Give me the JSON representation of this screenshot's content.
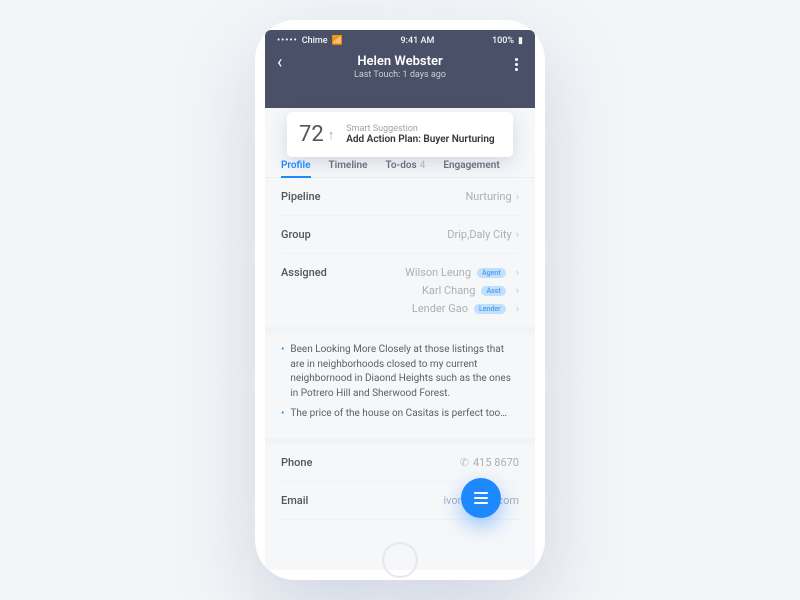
{
  "status": {
    "carrier": "Chime",
    "time": "9:41 AM",
    "battery": "100%"
  },
  "header": {
    "name": "Helen Webster",
    "subtitle": "Last Touch: 1 days ago"
  },
  "suggestion": {
    "score": "72",
    "label": "Smart Suggestion",
    "action": "Add Action Plan: Buyer Nurturing"
  },
  "tabs": {
    "profile": "Profile",
    "timeline": "Timeline",
    "todos": "To-dos",
    "todos_count": "4",
    "engagement": "Engagement"
  },
  "profile": {
    "pipeline_k": "Pipeline",
    "pipeline_v": "Nurturing",
    "group_k": "Group",
    "group_v": "Drip,Daly City",
    "assigned_k": "Assigned",
    "assigned": [
      {
        "name": "Wilson Leung",
        "role": "Agent"
      },
      {
        "name": "Karl Chang",
        "role": "Asst"
      },
      {
        "name": "Lender Gao",
        "role": "Lender"
      }
    ]
  },
  "notes": {
    "n1": "Been Looking More Closely at those listings that are in neighborhoods closed to my current neighbornood in Diaond Heights such as the ones in Potrero Hill and Sherwood Forest.",
    "n2": "The price of the house on Casitas is perfect too…"
  },
  "contact": {
    "phone_k": "Phone",
    "phone_v": "415            8670",
    "email_k": "Email",
    "email_v": "ivonneg@        .com"
  }
}
